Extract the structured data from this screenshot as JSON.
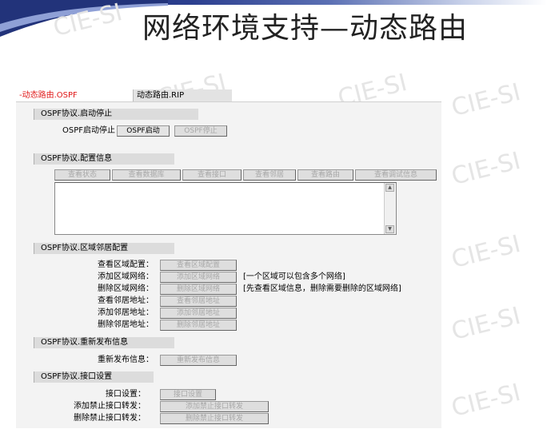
{
  "slide": {
    "title": "网络环境支持—动态路由",
    "watermark": "CIE-SI"
  },
  "tabs": [
    {
      "label": "-动态路由.OSPF",
      "active": true
    },
    {
      "label": "动态路由.RIP",
      "active": false
    }
  ],
  "sections": {
    "start_stop": {
      "header": "OSPF协议.启动停止",
      "row_label": "OSPF启动停止",
      "start_button": "OSPF启动",
      "stop_button": "OSPF停止"
    },
    "config": {
      "header": "OSPF协议.配置信息",
      "buttons": [
        "查看状态",
        "查看数据库",
        "查看接口",
        "查看邻居",
        "查看路由",
        "查看调试信息"
      ],
      "output_text": ""
    },
    "area": {
      "header": "OSPF协议.区域邻居配置",
      "rows": [
        {
          "label": "查看区域配置：",
          "button": "查看区域配置",
          "note": ""
        },
        {
          "label": "添加区域网络：",
          "button": "添加区域网络",
          "note": "[一个区域可以包含多个网络]"
        },
        {
          "label": "删除区域网络：",
          "button": "删除区域网络",
          "note": "[先查看区域信息，删除需要删除的区域网络]"
        },
        {
          "label": "查看邻居地址：",
          "button": "查看邻居地址",
          "note": ""
        },
        {
          "label": "添加邻居地址：",
          "button": "添加邻居地址",
          "note": ""
        },
        {
          "label": "删除邻居地址：",
          "button": "删除邻居地址",
          "note": ""
        }
      ]
    },
    "republish": {
      "header": "OSPF协议.重新发布信息",
      "row_label": "重新发布信息：",
      "button": "重新发布信息"
    },
    "interface": {
      "header": "OSPF协议.接口设置",
      "rows": [
        {
          "label": "接口设置：",
          "button": "接口设置"
        },
        {
          "label": "添加禁止接口转发：",
          "button": "添加禁止接口转发"
        },
        {
          "label": "删除禁止接口转发：",
          "button": "删除禁止接口转发"
        }
      ]
    }
  },
  "colors": {
    "active_tab_text": "#e01818",
    "section_header_bg": "#dcdcdc",
    "panel_bg": "#f3f3f3",
    "disabled_text": "#a8a8a8"
  }
}
